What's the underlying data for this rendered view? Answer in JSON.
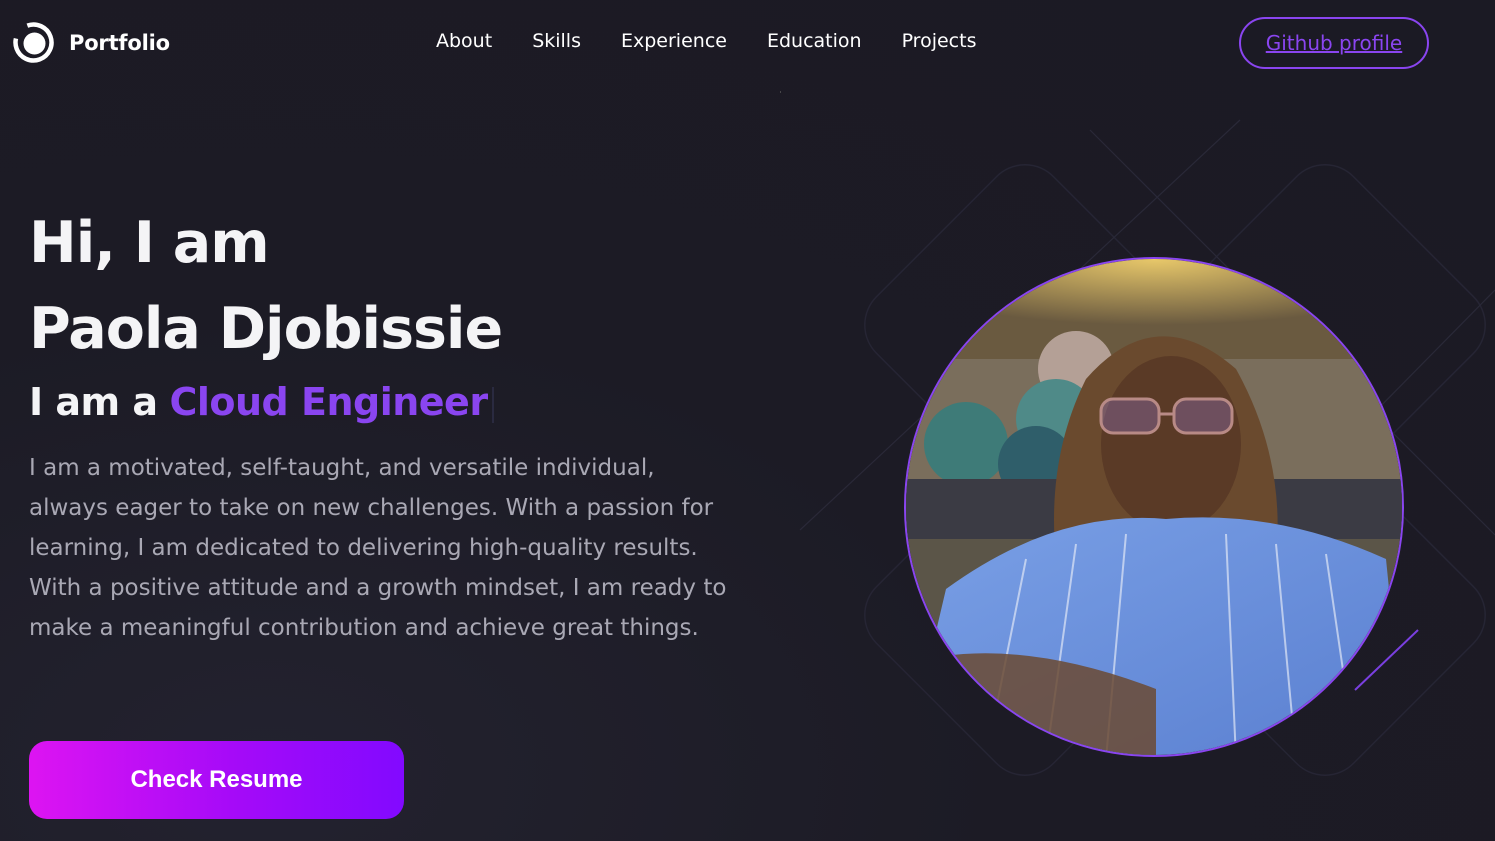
{
  "nav": {
    "brand": "Portfolio",
    "links": [
      "About",
      "Skills",
      "Experience",
      "Education",
      "Projects"
    ],
    "github_label": "Github profile"
  },
  "hero": {
    "greeting_line1": "Hi, I am",
    "name": "Paola Djobissie",
    "role_prefix": "I am a",
    "role_typed": "Cloud Engineer",
    "bio": "I am a motivated, self-taught, and versatile individual, always eager to take on new challenges. With a passion for learning, I am dedicated to delivering high-quality results. With a positive attitude and a growth mindset, I am ready to make a meaningful contribution and achieve great things.",
    "cta_label": "Check Resume"
  },
  "colors": {
    "background": "#1c1b25",
    "accent": "#8a45f0",
    "cta_gradient_start": "#dd14f2",
    "cta_gradient_end": "#8209ff",
    "body_text": "#a9a8b4"
  },
  "icons": {
    "logo": "ring-logo-icon"
  }
}
